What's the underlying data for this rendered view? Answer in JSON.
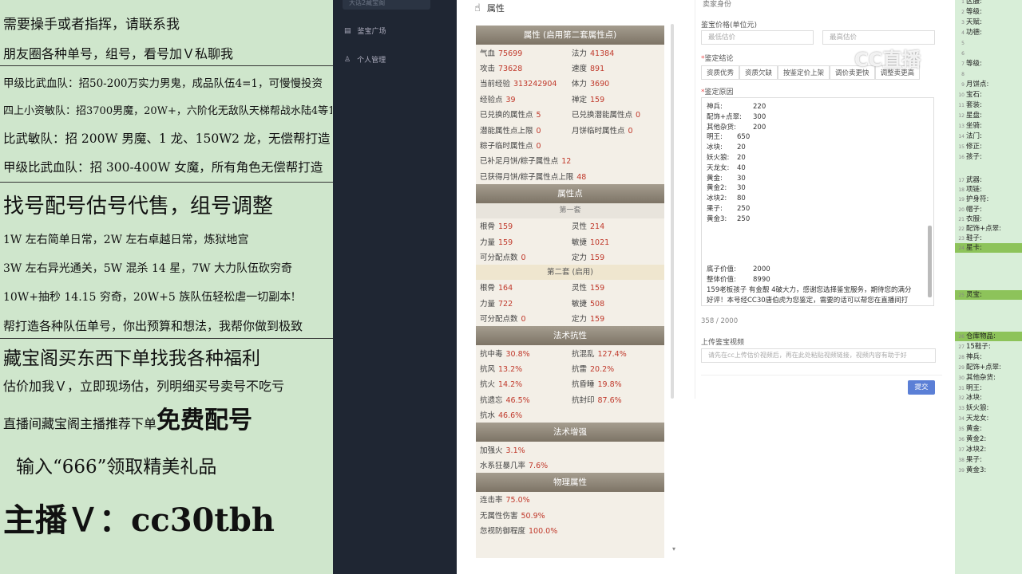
{
  "left_ads": {
    "l1": "需要操手或者指挥，请联系我",
    "l2": "朋友圈各种单号，组号，看号加Ｖ私聊我",
    "l3": "甲级比武血队：招50-200万实力男鬼，成品队伍4=1，可慢慢投资",
    "l4": "四上小资敏队：招3700男魔，20W+，六阶化无敌队天梯帮战水陆4等1",
    "l5": "比武敏队：招 200W 男魔、1 龙、150W2 龙，无偿帮打造",
    "l6": "甲级比武血队：招 300-400W 女魔，所有角色无偿帮打造",
    "l7": "找号配号估号代售，组号调整",
    "l8": "1W 左右简单日常，2W 左右卓越日常，炼狱地宫",
    "l9": "3W 左右异光通关，5W 混杀 14 星，7W 大力队伍砍穷奇",
    "l10": "10W+抽秒 14.15 穷奇，20W+5 族队伍轻松虐一切副本!",
    "l11": "帮打造各种队伍单号，你出预算和想法，我帮你做到极致",
    "l12": "藏宝阁买东西下单找我各种福利",
    "l13": "估价加我Ｖ，立即现场估，列明细买号卖号不吃亏",
    "l14a": "直播间藏宝阁主播推荐下单",
    "l14b": "免费配号",
    "l15": "输入“666”领取精美礼品",
    "l16": "主播Ｖ：cc30tbh"
  },
  "nav": {
    "title": "大话2藏宝阁",
    "item1": "鉴宝广场",
    "item2": "个人管理"
  },
  "attr_title": "属性",
  "attr": {
    "h1": "属性 (启用第二套属性点)",
    "rows1": [
      [
        "气血",
        "75699",
        "法力",
        "41384"
      ],
      [
        "攻击",
        "73628",
        "速度",
        "891"
      ],
      [
        "当前经验",
        "313242904",
        "体力",
        "3690"
      ],
      [
        "经验点",
        "39",
        "禅定",
        "159"
      ],
      [
        "已兑换的属性点",
        "5",
        "已兑换潜能属性点",
        "0"
      ],
      [
        "潜能属性点上限",
        "0",
        "月饼临时属性点",
        "0"
      ],
      [
        "粽子临时属性点",
        "0",
        "",
        ""
      ],
      [
        "已补足月饼/粽子属性点",
        "12",
        "",
        ""
      ],
      [
        "已获得月饼/粽子属性点上限",
        "48",
        "",
        ""
      ]
    ],
    "h2": "属性点",
    "sub1": "第一套",
    "rows2": [
      [
        "根骨",
        "159",
        "灵性",
        "214"
      ],
      [
        "力量",
        "159",
        "敏捷",
        "1021"
      ],
      [
        "可分配点数",
        "0",
        "定力",
        "159"
      ]
    ],
    "sub2": "第二套 (启用)",
    "rows3": [
      [
        "根骨",
        "164",
        "灵性",
        "159"
      ],
      [
        "力量",
        "722",
        "敏捷",
        "508"
      ],
      [
        "可分配点数",
        "0",
        "定力",
        "159"
      ]
    ],
    "h3": "法术抗性",
    "rows4": [
      [
        "抗中毒",
        "30.8%",
        "抗混乱",
        "127.4%"
      ],
      [
        "抗风",
        "13.2%",
        "抗雷",
        "20.2%"
      ],
      [
        "抗火",
        "14.2%",
        "抗昏睡",
        "19.8%"
      ],
      [
        "抗遗忘",
        "46.5%",
        "抗封印",
        "87.6%"
      ],
      [
        "抗水",
        "46.6%",
        "",
        ""
      ]
    ],
    "h4": "法术增强",
    "rows5": [
      [
        "加强火",
        "3.1%",
        "",
        ""
      ],
      [
        "水系狂暴几率",
        "7.6%",
        "",
        ""
      ]
    ],
    "h5": "物理属性",
    "rows6": [
      [
        "连击率",
        "75.0%",
        "",
        ""
      ],
      [
        "无属性伤害",
        "50.9%",
        "",
        ""
      ],
      [
        "忽视防御程度",
        "100.0%",
        "",
        ""
      ]
    ]
  },
  "form": {
    "top": "卖家身份",
    "price_label": "鉴宝价格(单位元)",
    "min_ph": "最低估价",
    "max_ph": "最高估价",
    "conclusion_label": "鉴定结论",
    "tags": [
      "资质优秀",
      "资质欠缺",
      "按鉴定价上架",
      "调价卖更快",
      "调整卖更高"
    ],
    "reason_label": "鉴定原因",
    "reason_lines": [
      [
        "神兵:",
        "220"
      ],
      [
        "配饰+点翠:",
        "300"
      ],
      [
        "其他杂货:",
        "200"
      ],
      [
        "明王:",
        "650"
      ],
      [
        "冰块:",
        "20"
      ],
      [
        "妖火狼:",
        "20"
      ],
      [
        "天龙女:",
        "40"
      ],
      [
        "黄金:",
        "30"
      ],
      [
        "黄金2:",
        "30"
      ],
      [
        "冰块2:",
        "80"
      ],
      [
        "果子:",
        "250"
      ],
      [
        "黄金3:",
        "250"
      ]
    ],
    "base_label": "底子价值:",
    "base_val": "2000",
    "total_label": "整体价值:",
    "total_val": "8990",
    "note1": "159老板孩子 有金靓 4破大力，感谢您选择鉴宝服务，期待您的满分",
    "note2": "好评！本号经CC30唐伯虎为您鉴定，需要的话可以帮您在直播间打",
    "counter": "358 / 2000",
    "video_label": "上传鉴宝视频",
    "video_ph": "请先在cc上传估价视频后，再在此处粘贴视频链接，视频内容有助于好",
    "submit": "提交"
  },
  "watermark": "CC直播",
  "sheet": {
    "top": [
      [
        "区服:",
        false
      ],
      [
        "等级:",
        false
      ],
      [
        "天赋:",
        false
      ],
      [
        "功德:",
        false
      ],
      [
        "",
        false
      ],
      [
        "",
        false
      ],
      [
        "等级:",
        false
      ],
      [
        "",
        false
      ],
      [
        "月饼点:",
        false
      ],
      [
        "宝石:",
        false
      ],
      [
        "套装:",
        false
      ],
      [
        "星盘:",
        false
      ],
      [
        "坐骑:",
        false
      ],
      [
        "法门:",
        false
      ],
      [
        "修正:",
        false
      ],
      [
        "孩子:",
        false
      ]
    ],
    "mid": [
      [
        "武器:",
        false
      ],
      [
        "项链:",
        false
      ],
      [
        "护身符:",
        false
      ],
      [
        "帽子:",
        false
      ],
      [
        "衣服:",
        false
      ],
      [
        "配饰+点翠:",
        false
      ],
      [
        "鞋子:",
        false
      ],
      [
        "星卡:",
        true
      ]
    ],
    "ling": "灵宝:",
    "bottom": [
      [
        "仓库物品:",
        true
      ],
      [
        "15鞋子:",
        false
      ],
      [
        "神兵:",
        false
      ],
      [
        "配饰+点翠:",
        false
      ],
      [
        "其他杂货:",
        false
      ],
      [
        "明王:",
        false
      ],
      [
        "冰块:",
        false
      ],
      [
        "妖火狼:",
        false
      ],
      [
        "天龙女:",
        false
      ],
      [
        "黄金:",
        false
      ],
      [
        "黄金2:",
        false
      ],
      [
        "冰块2:",
        false
      ],
      [
        "果子:",
        false
      ],
      [
        "黄金3:",
        false
      ]
    ],
    "green": "#8dc35a"
  }
}
